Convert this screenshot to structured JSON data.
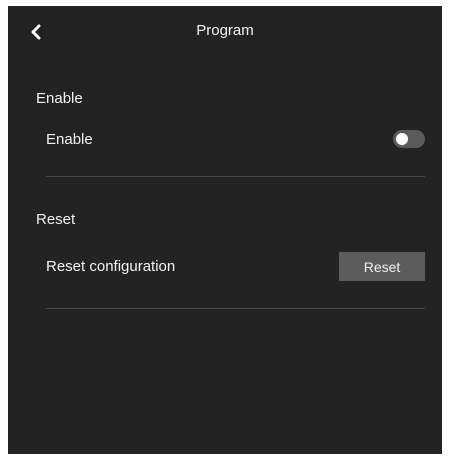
{
  "header": {
    "title": "Program",
    "back_icon": "chevron-left-icon"
  },
  "sections": [
    {
      "title": "Enable",
      "row_label": "Enable",
      "control": {
        "type": "toggle",
        "state": "off"
      }
    },
    {
      "title": "Reset",
      "row_label": "Reset configuration",
      "control": {
        "type": "button",
        "label": "Reset"
      }
    }
  ],
  "colors": {
    "background": "#232323",
    "divider": "#4a4a4a",
    "toggle_off": "#5a5a5a",
    "button_bg": "#5c5c5c",
    "text": "#f2f2f2"
  }
}
